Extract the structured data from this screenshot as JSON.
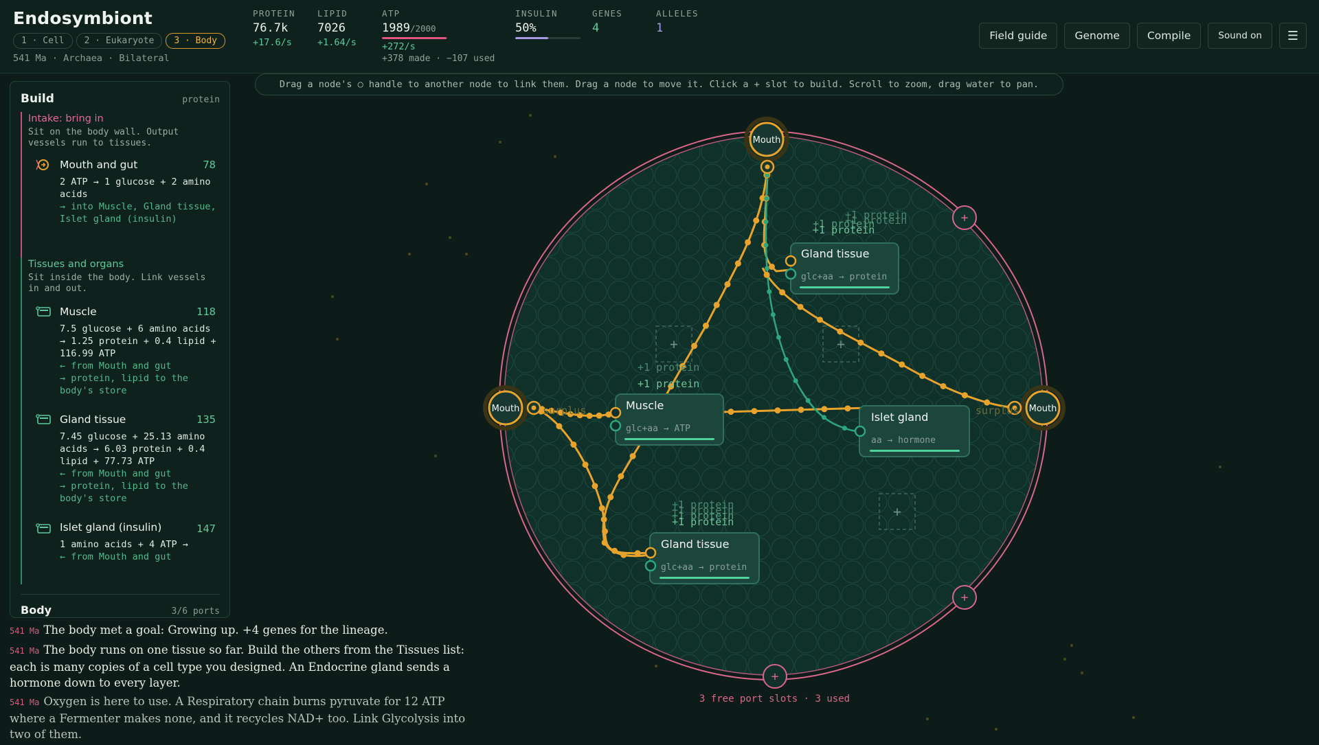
{
  "header": {
    "title": "Endosymbiont",
    "stages": [
      "1 · Cell",
      "2 · Eukaryote",
      "3 · Body"
    ],
    "active_stage": 2,
    "subline": "541 Ma · Archaea · Bilateral"
  },
  "stats": {
    "protein": {
      "label": "PROTEIN",
      "value": "76.7k",
      "rate": "+17.6/s"
    },
    "lipid": {
      "label": "LIPID",
      "value": "7026",
      "rate": "+1.64/s"
    },
    "atp": {
      "label": "ATP",
      "value": "1989",
      "cap": "/2000",
      "rate": "+272/s",
      "detail": "+378 made · −107 used",
      "fill_fraction": 0.99
    },
    "insulin": {
      "label": "INSULIN",
      "value": "50%",
      "fill_fraction": 0.5
    },
    "genes": {
      "label": "GENES",
      "value": "4"
    },
    "alleles": {
      "label": "ALLELES",
      "value": "1"
    }
  },
  "buttons": {
    "field_guide": "Field guide",
    "genome": "Genome",
    "compile": "Compile",
    "sound": "Sound on",
    "menu": "☰"
  },
  "hint": "Drag a node's ○ handle to another node to link them. Drag a node to move it. Click a + slot to build. Scroll to zoom, drag water to pan.",
  "build": {
    "title": "Build",
    "tag": "protein",
    "intake": {
      "title": "Intake: bring in",
      "desc": "Sit on the body wall. Output vessels run to tissues.",
      "items": [
        {
          "name": "Mouth and gut",
          "cost": "78",
          "rx": "2 ATP → 1 glucose + 2 amino acids",
          "io": [
            "→ into Muscle, Gland tissue, Islet gland (insulin)"
          ]
        }
      ]
    },
    "tissues": {
      "title": "Tissues and organs",
      "desc": "Sit inside the body. Link vessels in and out.",
      "items": [
        {
          "name": "Muscle",
          "cost": "118",
          "rx": "7.5 glucose + 6 amino acids → 1.25 protein + 0.4 lipid + 116.99 ATP",
          "io": [
            "← from Mouth and gut",
            "→ protein, lipid to the body's store"
          ]
        },
        {
          "name": "Gland tissue",
          "cost": "135",
          "rx": "7.45 glucose + 25.13 amino acids → 6.03 protein + 0.4 lipid + 77.73 ATP",
          "io": [
            "← from Mouth and gut",
            "→ protein, lipid to the body's store"
          ]
        },
        {
          "name": "Islet gland (insulin)",
          "cost": "147",
          "rx": "1 amino acids + 4 ATP →",
          "io": [
            "← from Mouth and gut"
          ]
        }
      ]
    },
    "body": {
      "title": "Body",
      "ports": "3/6 ports"
    }
  },
  "log": [
    {
      "ma": "541 Ma",
      "text": "The body met a goal: Growing up. +4 genes for the lineage."
    },
    {
      "ma": "541 Ma",
      "text": "The body runs on one tissue so far. Build the others from the Tissues list: each is many copies of a cell type you designed. An Endocrine gland sends a hormone down to every layer."
    },
    {
      "ma": "541 Ma",
      "text": "Oxygen is here to use. A Respiratory chain burns pyruvate for 12 ATP where a Fermenter makes none, and it recycles NAD+ too. Link Glycolysis into two of them."
    }
  ],
  "canvas": {
    "mouths": [
      {
        "label": "Mouth"
      },
      {
        "label": "Mouth"
      },
      {
        "label": "Mouth"
      }
    ],
    "nodes": [
      {
        "title": "Gland tissue",
        "rx": "glc+aa → protein",
        "floats": [
          "+1 protein",
          "+1 protein",
          "+1 protein",
          "+1 protein"
        ]
      },
      {
        "title": "Muscle",
        "rx": "glc+aa → ATP",
        "floats": [
          "+1 protein",
          "+1 protein"
        ]
      },
      {
        "title": "Islet gland",
        "rx": "aa → hormone",
        "floats": []
      },
      {
        "title": "Gland tissue",
        "rx": "glc+aa → protein",
        "floats": [
          "+1 protein",
          "+1 protein",
          "+1 protein",
          "+1 protein"
        ]
      }
    ],
    "surplus_label": "surplus",
    "ports_text": "3 free port slots · 3 used",
    "colors": {
      "membrane": "#d9668c",
      "vessel": "#e8a32c",
      "hormone": "#2fa57c",
      "body": "#10302a"
    }
  }
}
